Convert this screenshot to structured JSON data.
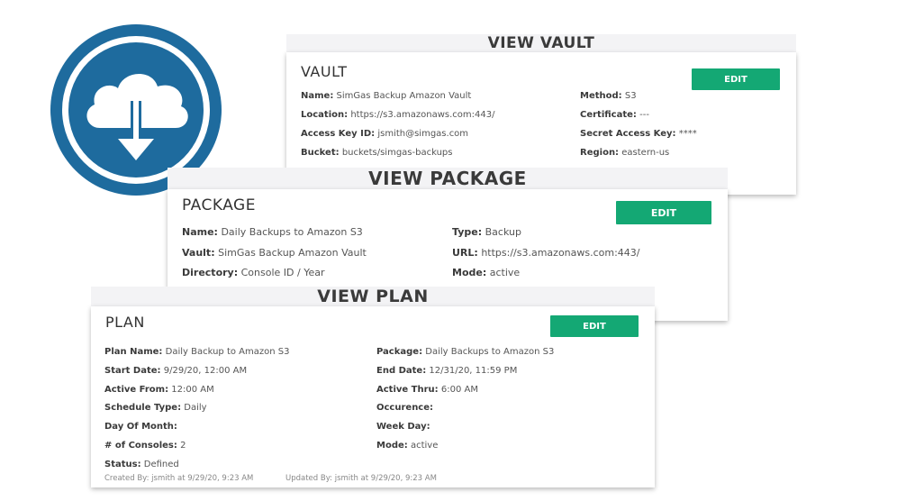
{
  "logo": {
    "icon": "cloud-download-icon",
    "color": "#1e6b9e"
  },
  "vault": {
    "header": "VIEW VAULT",
    "title": "VAULT",
    "edit_label": "EDIT",
    "fields": {
      "name": {
        "label": "Name:",
        "value": "SimGas Backup Amazon Vault"
      },
      "location": {
        "label": "Location:",
        "value": "https://s3.amazonaws.com:443/"
      },
      "access_key_id": {
        "label": "Access Key ID:",
        "value": "jsmith@simgas.com"
      },
      "bucket": {
        "label": "Bucket:",
        "value": "buckets/simgas-backups"
      },
      "method": {
        "label": "Method:",
        "value": "S3"
      },
      "certificate": {
        "label": "Certificate:",
        "value": "---"
      },
      "secret_access_key": {
        "label": "Secret Access Key:",
        "value": "****"
      },
      "region": {
        "label": "Region:",
        "value": "eastern-us"
      }
    }
  },
  "package": {
    "header": "VIEW PACKAGE",
    "title": "PACKAGE",
    "edit_label": "EDIT",
    "fields": {
      "name": {
        "label": "Name:",
        "value": "Daily Backups to Amazon S3"
      },
      "vault": {
        "label": "Vault:",
        "value": "SimGas Backup Amazon Vault"
      },
      "directory": {
        "label": "Directory:",
        "value": "Console ID / Year"
      },
      "type": {
        "label": "Type:",
        "value": "Backup"
      },
      "url": {
        "label": "URL:",
        "value": "https://s3.amazonaws.com:443/"
      },
      "mode": {
        "label": "Mode:",
        "value": "active"
      }
    }
  },
  "plan": {
    "header": "VIEW PLAN",
    "title": "PLAN",
    "edit_label": "EDIT",
    "fields": {
      "plan_name": {
        "label": "Plan Name:",
        "value": "Daily Backup to Amazon S3"
      },
      "start_date": {
        "label": "Start Date:",
        "value": "9/29/20, 12:00 AM"
      },
      "active_from": {
        "label": "Active From:",
        "value": "12:00 AM"
      },
      "schedule_type": {
        "label": "Schedule Type:",
        "value": "Daily"
      },
      "day_of_month": {
        "label": "Day Of Month:",
        "value": ""
      },
      "num_consoles": {
        "label": "# of Consoles:",
        "value": "2"
      },
      "status": {
        "label": "Status:",
        "value": "Defined"
      },
      "package": {
        "label": "Package:",
        "value": "Daily Backups to Amazon S3"
      },
      "end_date": {
        "label": "End Date:",
        "value": "12/31/20, 11:59 PM"
      },
      "active_thru": {
        "label": "Active Thru:",
        "value": "6:00 AM"
      },
      "occurence": {
        "label": "Occurence:",
        "value": ""
      },
      "week_day": {
        "label": "Week Day:",
        "value": ""
      },
      "mode": {
        "label": "Mode:",
        "value": "active"
      }
    },
    "created_by": {
      "label": "Created By:",
      "value": "jsmith at 9/29/20, 9:23 AM"
    },
    "updated_by": {
      "label": "Updated By:",
      "value": "jsmith at 9/29/20, 9:23 AM"
    }
  }
}
